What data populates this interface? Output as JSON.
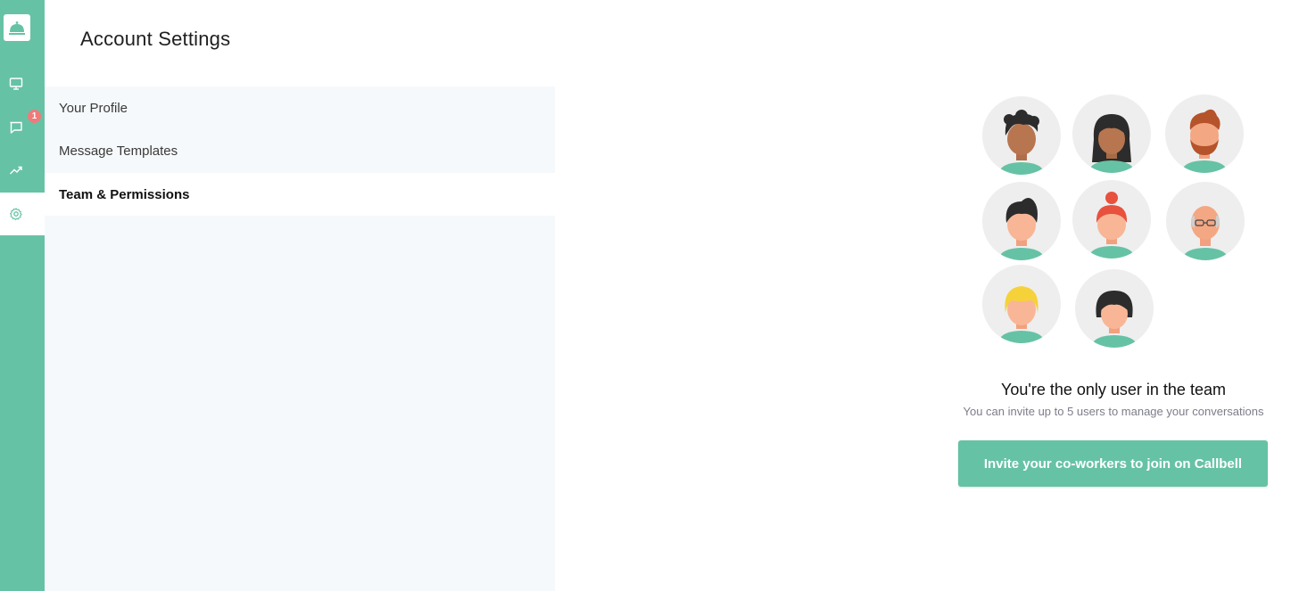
{
  "rail": {
    "logo_icon": "bell-icon",
    "items": [
      {
        "name": "inbox",
        "icon": "monitor-icon"
      },
      {
        "name": "conversations",
        "icon": "chat-bubble-icon",
        "badge": "1"
      },
      {
        "name": "analytics",
        "icon": "trend-icon"
      },
      {
        "name": "settings",
        "icon": "gear-icon",
        "active": true
      }
    ]
  },
  "header": {
    "title": "Account Settings"
  },
  "menu": {
    "items": [
      {
        "label": "Your Profile"
      },
      {
        "label": "Message Templates"
      },
      {
        "label": "Team & Permissions",
        "active": true
      }
    ]
  },
  "empty_state": {
    "title": "You're the only user in the team",
    "subtitle": "You can invite up to 5 users to manage your conversations",
    "button_label": "Invite your co-workers to join on Callbell"
  },
  "colors": {
    "accent": "#66c2a5",
    "badge": "#f07a7a",
    "panel": "#f5f9fb"
  }
}
